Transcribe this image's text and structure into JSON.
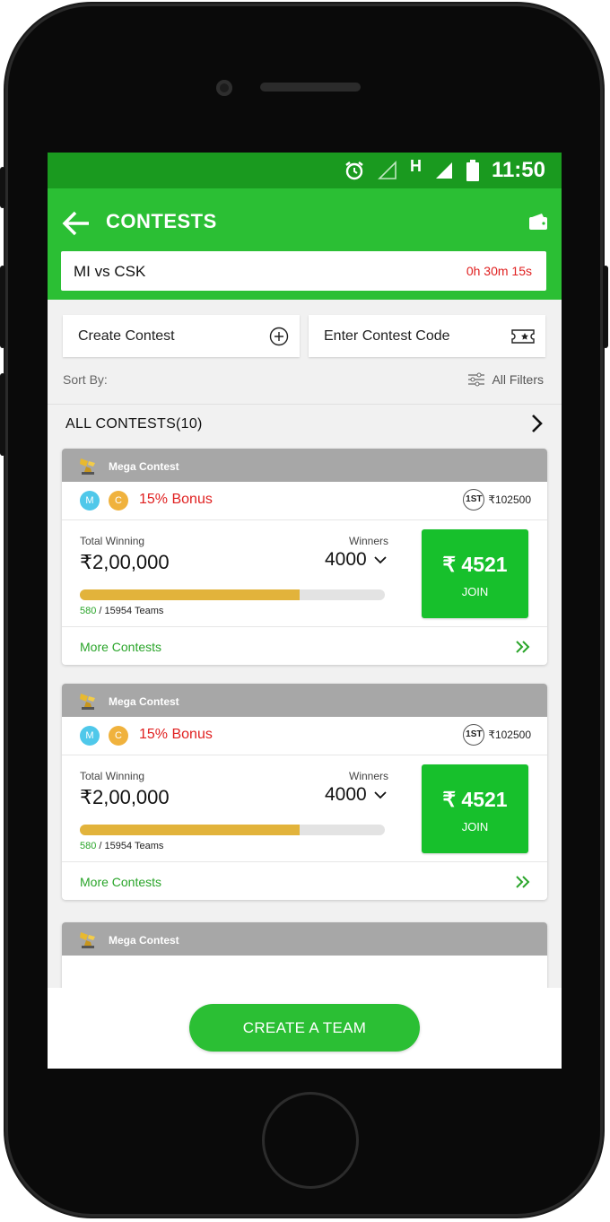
{
  "status": {
    "time": "11:50",
    "network": "H"
  },
  "appbar": {
    "title": "CONTESTS",
    "back_icon": "arrow-left-icon",
    "wallet_icon": "wallet-icon"
  },
  "match": {
    "name": "MI vs CSK",
    "timer": "0h 30m 15s"
  },
  "actions": {
    "create_label": "Create Contest",
    "code_label": "Enter Contest Code"
  },
  "sort": {
    "label": "Sort By:",
    "filters_label": "All Filters"
  },
  "all_contests": {
    "label": "ALL CONTESTS(10)"
  },
  "contests": [
    {
      "title": "Mega Contest",
      "badge_m": "M",
      "badge_c": "C",
      "bonus": "15% Bonus",
      "first_prize_badge": "1ST",
      "first_prize": "₹102500",
      "total_winning_label": "Total Winning",
      "total_winning": "₹2,00,000",
      "winners_label": "Winners",
      "winners": "4000",
      "joined": "580",
      "teams_total": "/ 15954 Teams",
      "fill_fraction": 0.72,
      "join_amount": "₹ 4521",
      "join_label": "JOIN",
      "more_label": "More Contests"
    },
    {
      "title": "Mega Contest",
      "badge_m": "M",
      "badge_c": "C",
      "bonus": "15% Bonus",
      "first_prize_badge": "1ST",
      "first_prize": "₹102500",
      "total_winning_label": "Total Winning",
      "total_winning": "₹2,00,000",
      "winners_label": "Winners",
      "winners": "4000",
      "joined": "580",
      "teams_total": "/ 15954 Teams",
      "fill_fraction": 0.72,
      "join_amount": "₹ 4521",
      "join_label": "JOIN",
      "more_label": "More Contests"
    },
    {
      "title": "Mega Contest"
    }
  ],
  "bottom": {
    "create_team_label": "CREATE A TEAM"
  },
  "colors": {
    "green": "#2bbf34",
    "dark_green": "#1a9a1f",
    "join_green": "#17c02c",
    "bonus_red": "#e02020",
    "progress": "#e2b33b",
    "badge_m": "#4fc8ea",
    "badge_c": "#f0b23d"
  }
}
